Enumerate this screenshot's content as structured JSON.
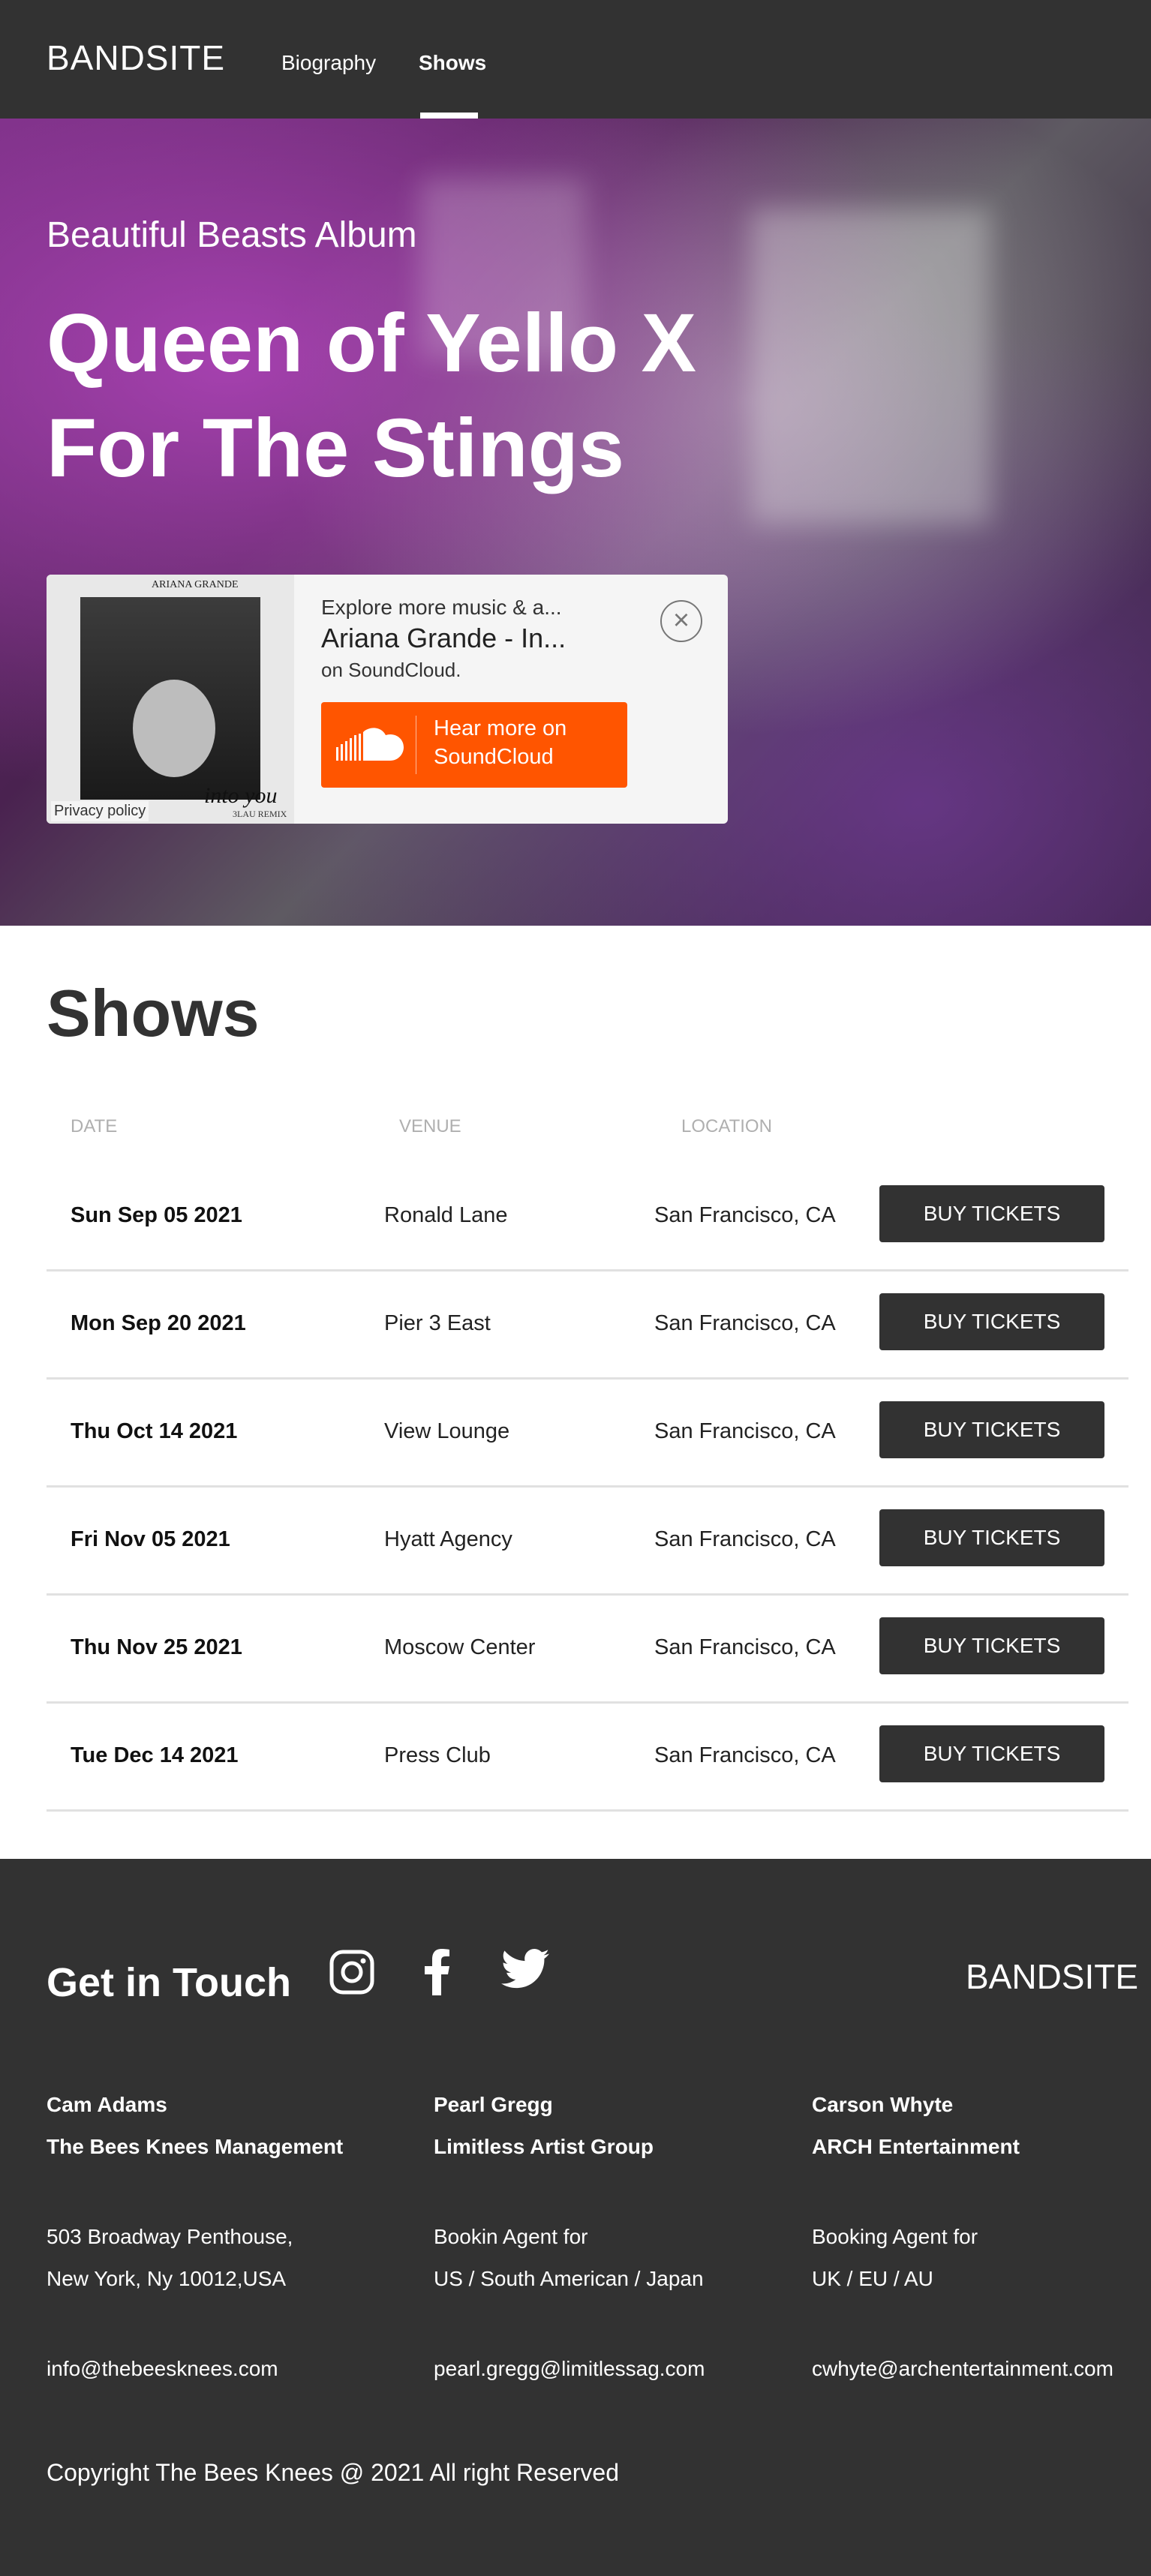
{
  "header": {
    "logo": "BANDSITE",
    "nav": [
      {
        "label": "Biography"
      },
      {
        "label": "Shows"
      }
    ]
  },
  "hero": {
    "subtitle": "Beautiful Beasts Album",
    "title_line1": "Queen of Yello X",
    "title_line2": "For The Stings",
    "embed": {
      "line1": "Explore more music & a...",
      "line2": "Ariana Grande - In...",
      "line3": "on SoundCloud.",
      "button_line1": "Hear more on",
      "button_line2": "SoundCloud",
      "privacy": "Privacy policy",
      "art_caption": "ARIANA GRANDE",
      "art_script": "into you",
      "art_remix": "3LAU REMIX",
      "close": "×"
    }
  },
  "shows": {
    "title": "Shows",
    "columns": [
      "DATE",
      "VENUE",
      "LOCATION"
    ],
    "button_label": "BUY TICKETS",
    "rows": [
      {
        "date": "Sun Sep 05 2021",
        "venue": "Ronald Lane",
        "location": "San Francisco, CA"
      },
      {
        "date": "Mon Sep 20 2021",
        "venue": "Pier 3 East",
        "location": "San Francisco, CA"
      },
      {
        "date": "Thu Oct 14 2021",
        "venue": "View Lounge",
        "location": "San Francisco, CA"
      },
      {
        "date": "Fri Nov 05 2021",
        "venue": "Hyatt Agency",
        "location": "San Francisco, CA"
      },
      {
        "date": "Thu Nov 25 2021",
        "venue": "Moscow Center",
        "location": "San Francisco, CA"
      },
      {
        "date": "Tue Dec 14 2021",
        "venue": "Press Club",
        "location": "San Francisco, CA"
      }
    ]
  },
  "footer": {
    "title": "Get in Touch",
    "logo": "BANDSITE",
    "social_icons": [
      "instagram-icon",
      "facebook-icon",
      "twitter-icon"
    ],
    "contacts": [
      {
        "name": "Cam Adams",
        "company": "The Bees Knees Management",
        "line1": "503 Broadway Penthouse,",
        "line2": "New York, Ny 10012,USA",
        "email": "info@thebeesknees.com"
      },
      {
        "name": "Pearl Gregg",
        "company": "Limitless Artist Group",
        "line1": "Bookin Agent for",
        "line2": "US / South American / Japan",
        "email": "pearl.gregg@limitlessag.com"
      },
      {
        "name": "Carson Whyte",
        "company": "ARCH Entertainment",
        "line1": "Booking Agent for",
        "line2": "UK / EU / AU",
        "email": "cwhyte@archentertainment.com"
      }
    ],
    "copyright": "Copyright The Bees Knees @ 2021 All right Reserved"
  },
  "colors": {
    "dark": "#323232",
    "soundcloud_orange": "#ff5500",
    "muted": "#afafaf",
    "divider": "#e1e1e1"
  }
}
